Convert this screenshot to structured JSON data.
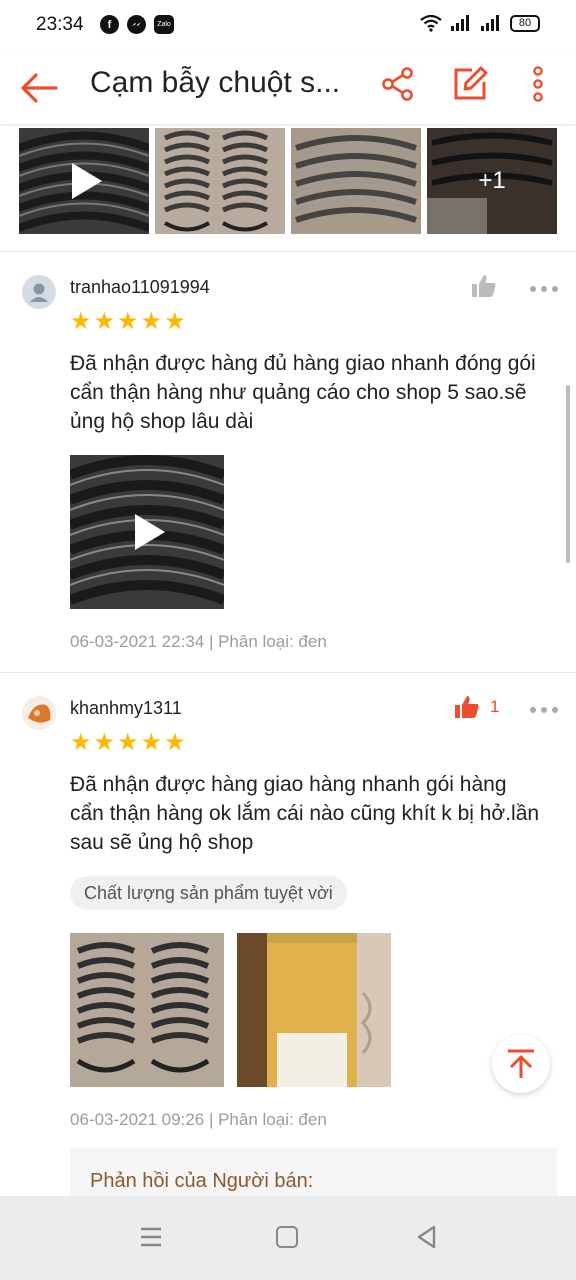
{
  "status": {
    "time": "23:34",
    "zalo_label": "Zalo",
    "battery": "80"
  },
  "header": {
    "title": "Cạm bẫy chuột s..."
  },
  "media_strip": {
    "more_count": "+1"
  },
  "reviews": [
    {
      "username": "tranhao11091994",
      "rating": 5,
      "like_count": "",
      "text": "Đã nhận được hàng đủ hàng giao nhanh đóng gói cẩn thận hàng như quảng cáo cho shop 5 sao.sẽ ủng hộ shop lâu dài",
      "meta": "06-03-2021 22:34 | Phân loại: đen"
    },
    {
      "username": "khanhmy1311",
      "rating": 5,
      "like_count": "1",
      "text": "Đã nhận được hàng giao hàng nhanh gói hàng cẩn thận hàng ok lắm cái nào cũng khít k bị hở.lần sau sẽ ủng hộ shop",
      "tag": "Chất lượng sản phẩm tuyệt vời",
      "meta": "06-03-2021 09:26 | Phân loại: đen",
      "seller_reply_label": "Phản hồi của Người bán:"
    }
  ],
  "colors": {
    "accent": "#ee4d2d",
    "star": "#ffb800"
  }
}
